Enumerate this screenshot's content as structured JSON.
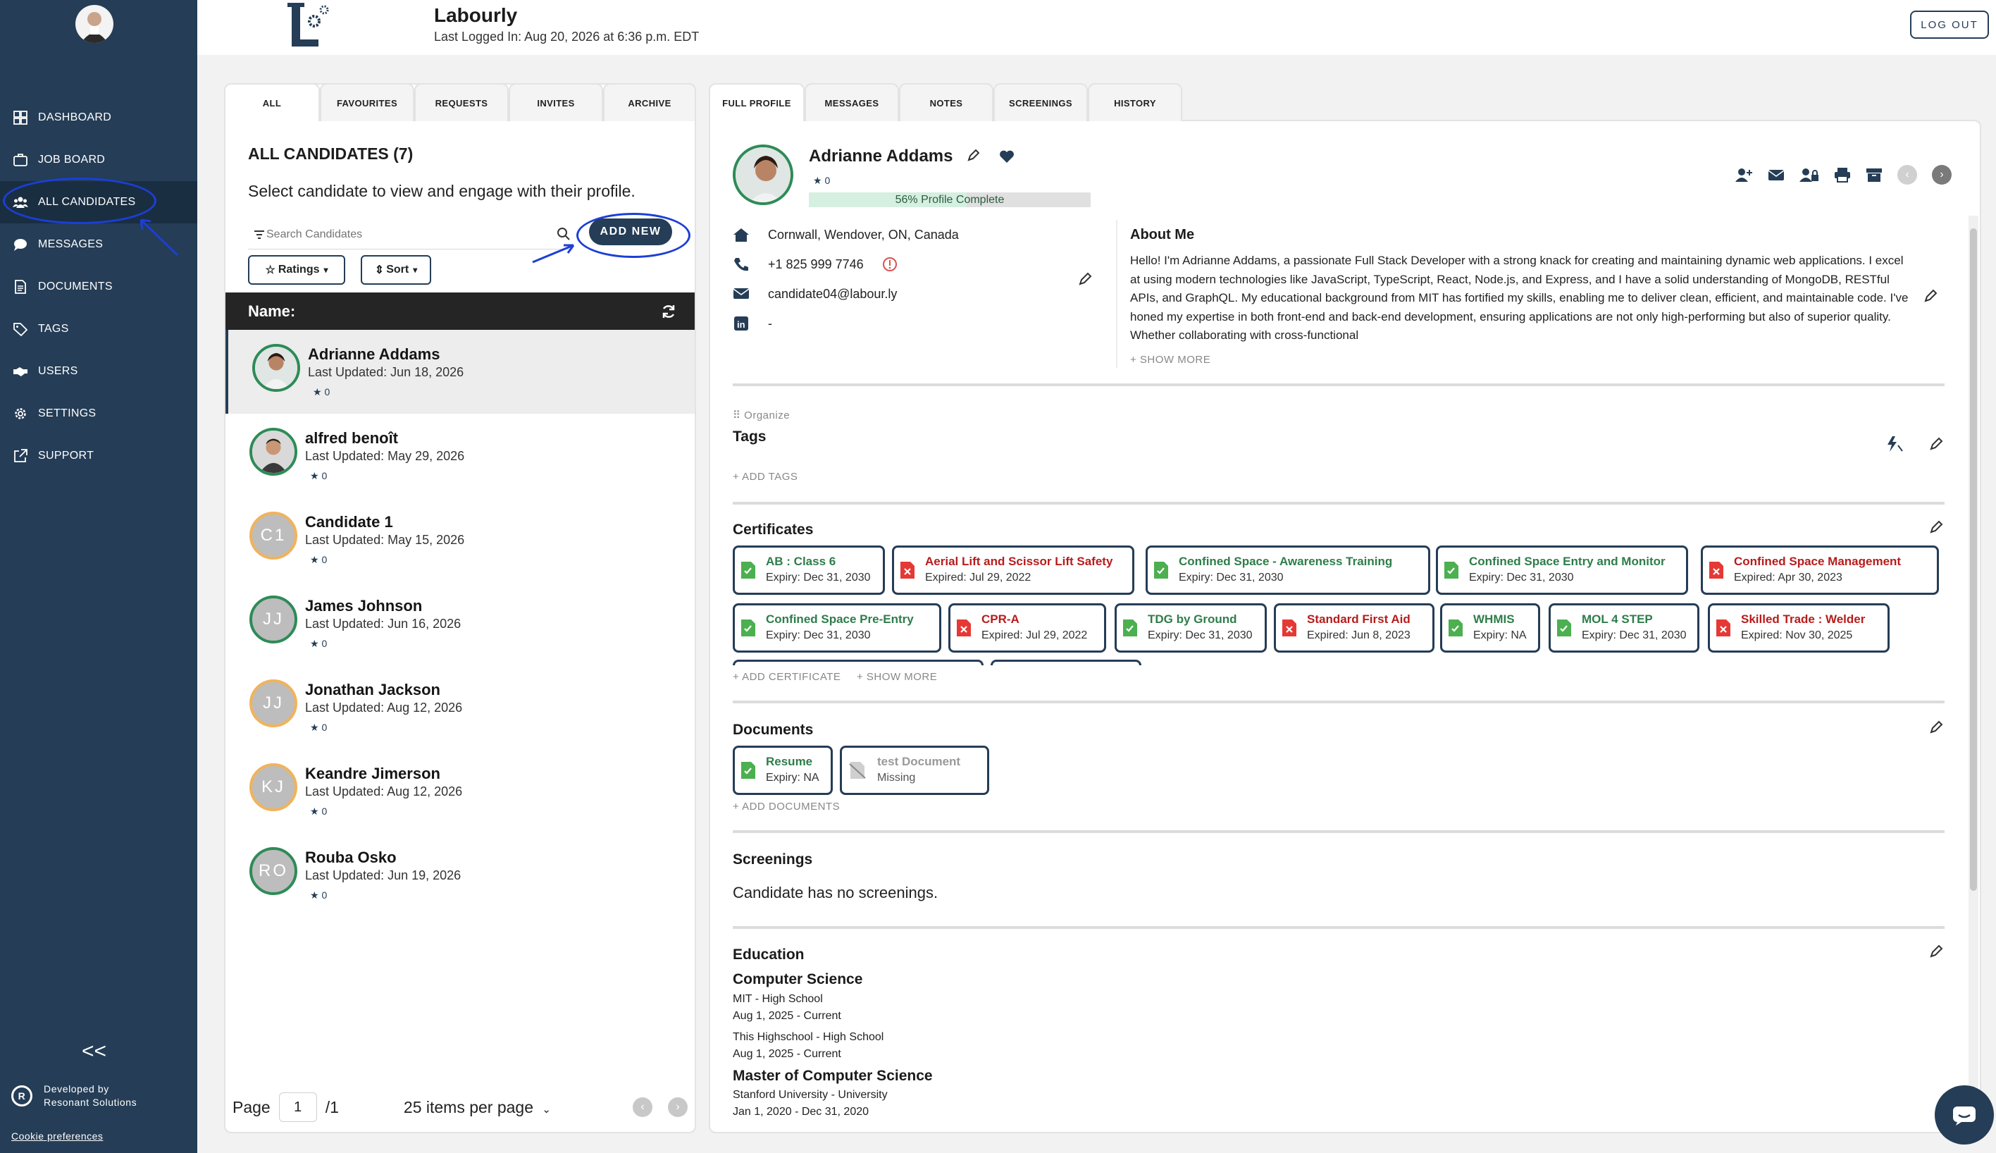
{
  "app": {
    "title": "Labourly",
    "last_login": "Last Logged In: Aug 20, 2026 at 6:36 p.m. EDT",
    "logout_label": "LOG OUT"
  },
  "sidebar": {
    "items": [
      {
        "label": "DASHBOARD",
        "icon": "dashboard-icon"
      },
      {
        "label": "JOB BOARD",
        "icon": "briefcase-icon"
      },
      {
        "label": "ALL CANDIDATES",
        "icon": "users-icon"
      },
      {
        "label": "MESSAGES",
        "icon": "chat-bubble-icon"
      },
      {
        "label": "DOCUMENTS",
        "icon": "document-icon"
      },
      {
        "label": "TAGS",
        "icon": "tag-icon"
      },
      {
        "label": "USERS",
        "icon": "handshake-icon"
      },
      {
        "label": "SETTINGS",
        "icon": "gear-icon"
      },
      {
        "label": "SUPPORT",
        "icon": "external-link-icon"
      }
    ],
    "active": "ALL CANDIDATES",
    "collapse_glyph": "<<",
    "developed_by": "Developed by",
    "developer": "Resonant Solutions",
    "cookie": "Cookie preferences"
  },
  "left": {
    "tabs": [
      "ALL",
      "FAVOURITES",
      "REQUESTS",
      "INVITES",
      "ARCHIVE"
    ],
    "active_tab": "ALL",
    "title": "ALL CANDIDATES (7)",
    "description": "Select candidate to view and engage with their profile.",
    "search_placeholder": "Search Candidates",
    "add_new": "ADD NEW",
    "ratings_label": "Ratings",
    "sort_label": "Sort",
    "name_header": "Name:",
    "candidates": [
      {
        "name": "Adrianne Addams",
        "updated": "Last Updated: Jun 18, 2026",
        "rating": "0",
        "initials": "",
        "selected": true
      },
      {
        "name": "alfred benoît",
        "updated": "Last Updated: May 29, 2026",
        "rating": "0",
        "initials": ""
      },
      {
        "name": "Candidate 1",
        "updated": "Last Updated: May 15, 2026",
        "rating": "0",
        "initials": "C1"
      },
      {
        "name": "James Johnson",
        "updated": "Last Updated: Jun 16, 2026",
        "rating": "0",
        "initials": "JJ"
      },
      {
        "name": "Jonathan Jackson",
        "updated": "Last Updated: Aug 12, 2026",
        "rating": "0",
        "initials": "JJ"
      },
      {
        "name": "Keandre Jimerson",
        "updated": "Last Updated: Aug 12, 2026",
        "rating": "0",
        "initials": "KJ"
      },
      {
        "name": "Rouba Osko",
        "updated": "Last Updated: Jun 19, 2026",
        "rating": "0",
        "initials": "RO"
      }
    ],
    "pager": {
      "page_label": "Page",
      "page": "1",
      "total": "/1",
      "per_page": "25 items per page"
    }
  },
  "right": {
    "tabs": [
      "FULL PROFILE",
      "MESSAGES",
      "NOTES",
      "SCREENINGS",
      "HISTORY"
    ],
    "active_tab": "FULL PROFILE",
    "profile": {
      "name": "Adrianne Addams",
      "rating": "0",
      "complete_label": "56% Profile Complete",
      "complete_pct": 56,
      "address": "Cornwall, Wendover, ON, Canada",
      "phone": "+1 825 999 7746",
      "email": "candidate04@labour.ly",
      "linkedin": "-"
    },
    "about": {
      "heading": "About Me",
      "text": "Hello! I'm Adrianne Addams, a passionate Full Stack Developer with a strong knack for creating and maintaining dynamic web applications. I excel at using modern technologies like JavaScript, TypeScript, React, Node.js, and Express, and I have a solid understanding of MongoDB, RESTful APIs, and GraphQL. My educational background from MIT has fortified my skills, enabling me to deliver clean, efficient, and maintainable code. I've honed my expertise in both front-end and back-end development, ensuring applications are not only high-performing but also of superior quality. Whether collaborating with cross-functional",
      "show_more": "+ SHOW MORE"
    },
    "organize_label": "Organize",
    "tags": {
      "heading": "Tags",
      "add": "+ ADD TAGS"
    },
    "certificates": {
      "heading": "Certificates",
      "items": [
        {
          "title": "AB : Class 6",
          "expiry": "Expiry: Dec 31, 2030",
          "status": "ok"
        },
        {
          "title": "Aerial Lift and Scissor Lift Safety",
          "expiry": "Expired: Jul 29, 2022",
          "status": "bad"
        },
        {
          "title": "Confined Space - Awareness Training",
          "expiry": "Expiry: Dec 31, 2030",
          "status": "ok"
        },
        {
          "title": "Confined Space Entry and Monitor",
          "expiry": "Expiry: Dec 31, 2030",
          "status": "ok"
        },
        {
          "title": "Confined Space Management",
          "expiry": "Expired: Apr 30, 2023",
          "status": "bad"
        },
        {
          "title": "Confined Space Pre-Entry",
          "expiry": "Expiry: Dec 31, 2030",
          "status": "ok"
        },
        {
          "title": "CPR-A",
          "expiry": "Expired: Jul 29, 2022",
          "status": "bad"
        },
        {
          "title": "TDG by Ground",
          "expiry": "Expiry: Dec 31, 2030",
          "status": "ok"
        },
        {
          "title": "Standard First Aid",
          "expiry": "Expired: Jun 8, 2023",
          "status": "bad"
        },
        {
          "title": "WHMIS",
          "expiry": "Expiry: NA",
          "status": "ok"
        },
        {
          "title": "MOL 4 STEP",
          "expiry": "Expiry: Dec 31, 2030",
          "status": "ok"
        },
        {
          "title": "Skilled Trade : Welder",
          "expiry": "Expired: Nov 30, 2025",
          "status": "bad"
        }
      ],
      "add": "+ ADD CERTIFICATE",
      "show_more": "+ SHOW MORE"
    },
    "documents": {
      "heading": "Documents",
      "items": [
        {
          "title": "Resume",
          "expiry": "Expiry: NA",
          "status": "ok"
        },
        {
          "title": "test Document",
          "expiry": "Missing",
          "status": "miss"
        }
      ],
      "add": "+ ADD DOCUMENTS"
    },
    "screenings": {
      "heading": "Screenings",
      "empty": "Candidate has no screenings."
    },
    "education": {
      "heading": "Education",
      "items": [
        {
          "degree": "Computer Science",
          "school": "MIT - High School",
          "dates": "Aug 1, 2025 - Current",
          "school2": "This Highschool - High School",
          "dates2": "Aug 1, 2025 - Current"
        },
        {
          "degree": "Master of Computer Science",
          "school": "Stanford University - University",
          "dates": "Jan 1, 2020 - Dec 31, 2020"
        }
      ]
    }
  },
  "colors": {
    "navy": "#253d56",
    "green": "#2e7d4a",
    "red": "#b71c1c",
    "annotation": "#1b3fd6"
  }
}
